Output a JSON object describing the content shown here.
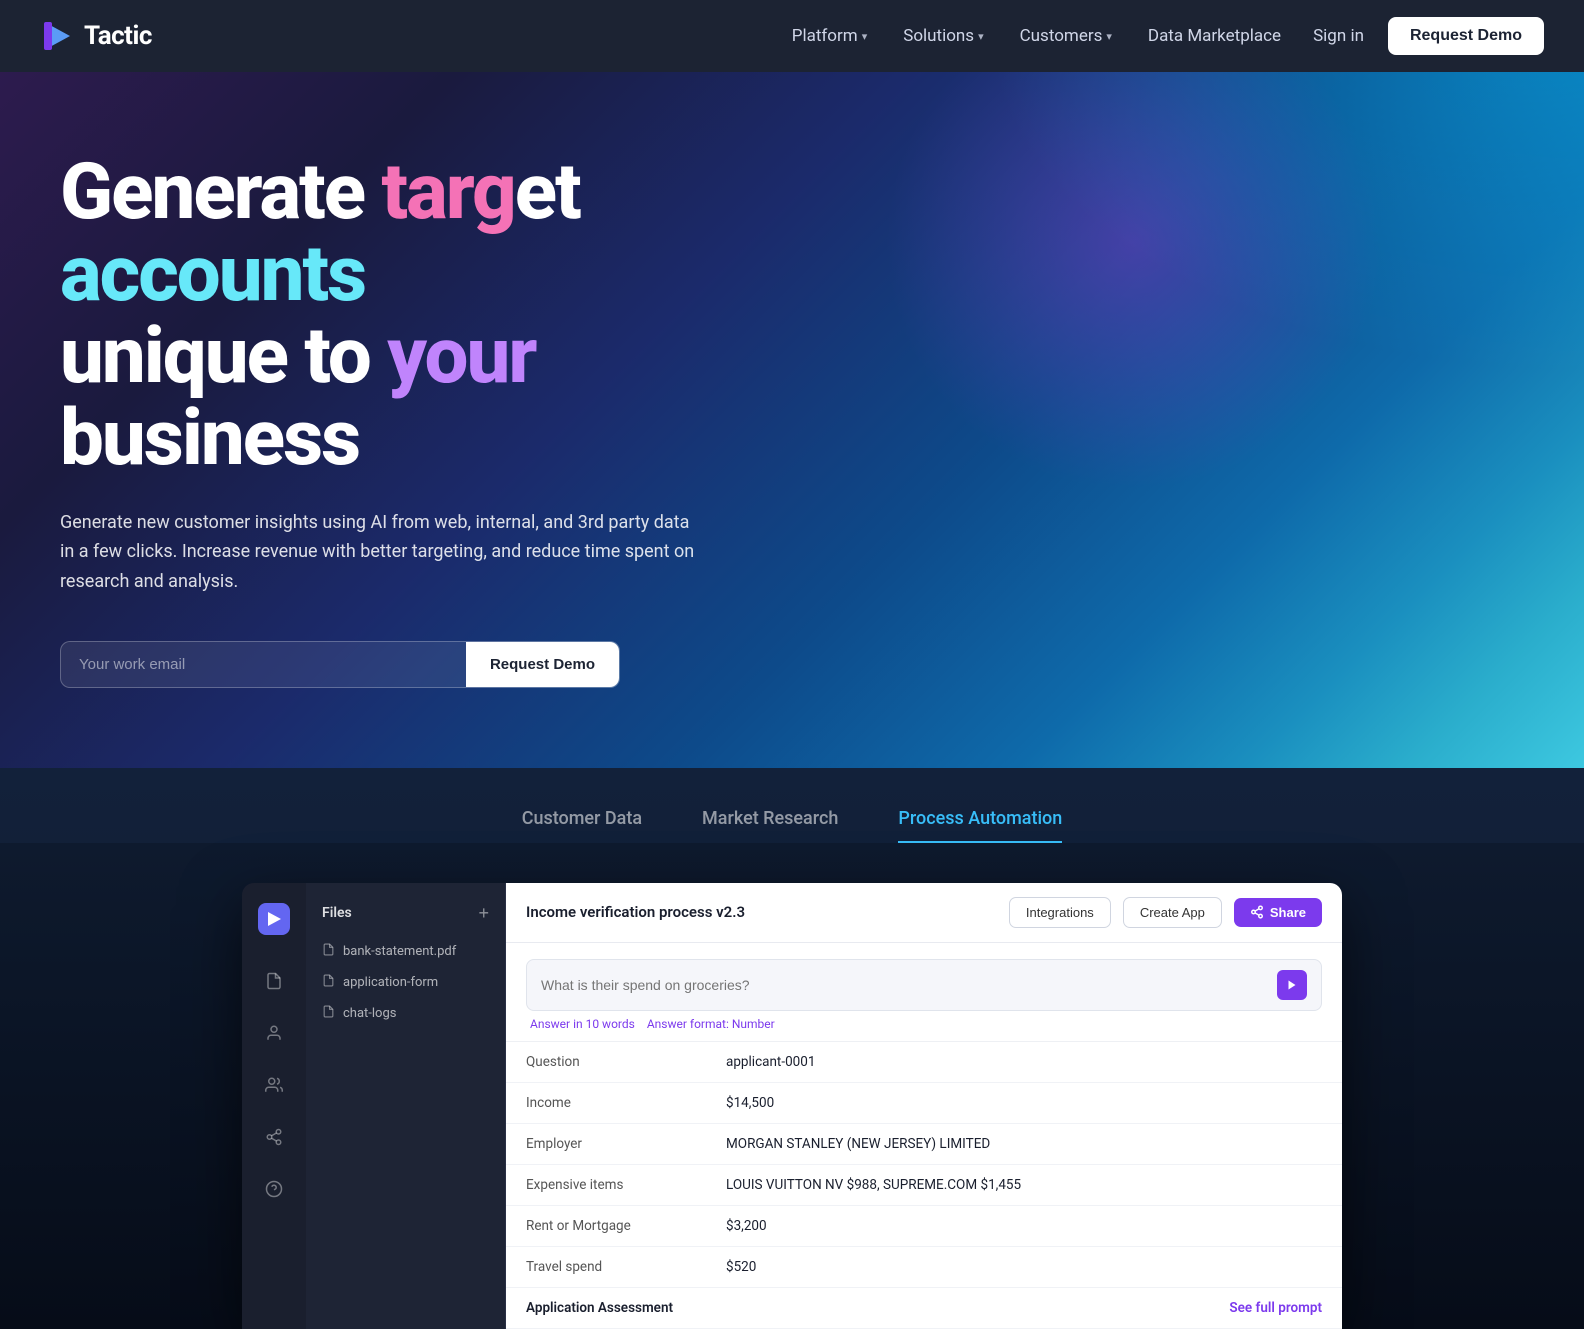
{
  "nav": {
    "logo_text": "Tactic",
    "links": [
      {
        "label": "Platform",
        "has_dropdown": true
      },
      {
        "label": "Solutions",
        "has_dropdown": true
      },
      {
        "label": "Customers",
        "has_dropdown": true
      },
      {
        "label": "Data Marketplace",
        "has_dropdown": false
      }
    ],
    "signin_label": "Sign in",
    "cta_label": "Request Demo"
  },
  "hero": {
    "title_line1_white": "Generate ",
    "title_line1_pink": "targ",
    "title_line1_white2": "et ",
    "title_line1_cyan": "accounts",
    "title_line2_white": "unique to ",
    "title_line2_purple": "your ",
    "title_line2_white2": "business",
    "subtitle": "Generate new customer insights using AI from web, internal, and 3rd party data in a few clicks. Increase revenue with better targeting, and reduce time spent on research and analysis.",
    "email_placeholder": "Your work email",
    "cta_label": "Request Demo"
  },
  "tabs": [
    {
      "label": "Customer Data",
      "active": false
    },
    {
      "label": "Market Research",
      "active": false
    },
    {
      "label": "Process Automation",
      "active": true
    }
  ],
  "app": {
    "title": "Income verification process v2.3",
    "btn_integrations": "Integrations",
    "btn_create_app": "Create App",
    "btn_share": "Share",
    "files_label": "Files",
    "files_add": "+",
    "files": [
      {
        "name": "bank-statement.pdf"
      },
      {
        "name": "application-form"
      },
      {
        "name": "chat-logs"
      }
    ],
    "query_placeholder": "What is their spend on groceries?",
    "query_hint1": "Answer in 10 words",
    "query_hint2": "Answer format: Number",
    "table_rows": [
      {
        "label": "Question",
        "value": "applicant-0001"
      },
      {
        "label": "Income",
        "value": "$14,500"
      },
      {
        "label": "Employer",
        "value": "MORGAN STANLEY (NEW JERSEY) LIMITED"
      },
      {
        "label": "Expensive items",
        "value": "LOUIS VUITTON NV $988, SUPREME.COM $1,455"
      },
      {
        "label": "Rent or Mortgage",
        "value": "$3,200"
      },
      {
        "label": "Travel spend",
        "value": "$520"
      }
    ],
    "assessment_label": "Application Assessment",
    "see_full_prompt": "See full prompt"
  },
  "icons": {
    "logo_play": "▶",
    "chevron_down": "▾",
    "share_icon": "⤢",
    "file_doc": "📄",
    "submit_arrow": "▶",
    "sidebar_file": "☰",
    "sidebar_user": "👤",
    "sidebar_users": "👥",
    "sidebar_share": "⤢",
    "sidebar_help": "?"
  }
}
